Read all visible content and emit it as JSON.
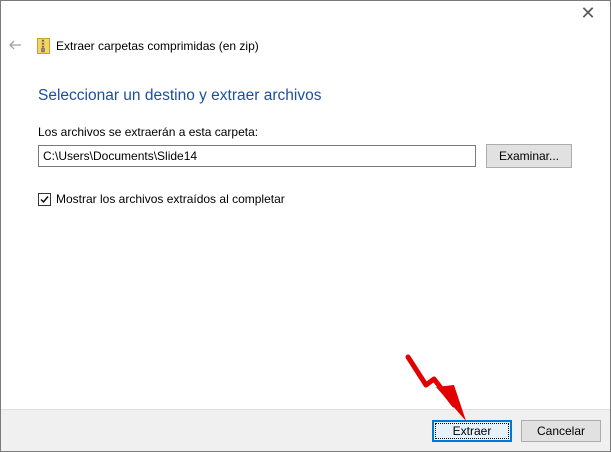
{
  "window": {
    "close_glyph": "✕"
  },
  "header": {
    "title": "Extraer carpetas comprimidas (en zip)",
    "back_icon": "back-arrow-icon",
    "app_icon": "zip-folder-icon"
  },
  "main": {
    "heading": "Seleccionar un destino y extraer archivos",
    "dest_label": "Los archivos se extraerán a esta carpeta:",
    "path_value": "C:\\Users\\Documents\\Slide14",
    "browse_label": "Examinar...",
    "show_files_label": "Mostrar los archivos extraídos al completar",
    "show_files_checked": true
  },
  "footer": {
    "extract_label": "Extraer",
    "cancel_label": "Cancelar"
  },
  "colors": {
    "heading": "#1b4f9c",
    "default_button_border": "#0078d7",
    "annotation_arrow": "#e00000"
  }
}
